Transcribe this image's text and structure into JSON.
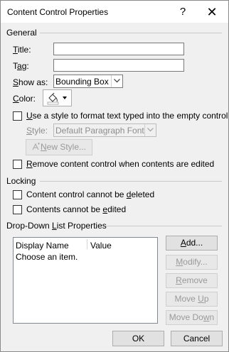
{
  "window": {
    "title": "Content Control Properties",
    "help_glyph": "?",
    "close_glyph": "✕"
  },
  "general": {
    "heading": "General",
    "title_label_ul": "T",
    "title_label_rest": "itle:",
    "title_value": "",
    "tag_label_pre": "T",
    "tag_label_ul": "a",
    "tag_label_rest": "g:",
    "tag_value": "",
    "show_as_label_ul": "S",
    "show_as_label_rest": "how as:",
    "show_as_value": "Bounding Box",
    "color_label_ul": "C",
    "color_label_rest": "olor:",
    "use_style_ul": "U",
    "use_style_rest": "se a style to format text typed into the empty control",
    "use_style_checked": false,
    "style_label_ul": "S",
    "style_label_rest": "tyle:",
    "style_value": "Default Paragraph Font",
    "new_style_label_ul": "N",
    "new_style_label_rest": "ew Style...",
    "remove_label_pre": "",
    "remove_label_ul": "R",
    "remove_label_rest": "emove content control when contents are edited",
    "remove_checked": false
  },
  "locking": {
    "heading": "Locking",
    "cannot_delete_pre": "Content control cannot be ",
    "cannot_delete_ul": "d",
    "cannot_delete_rest": "eleted",
    "cannot_delete_checked": false,
    "cannot_edit_pre": "Contents cannot be ",
    "cannot_edit_ul": "e",
    "cannot_edit_rest": "dited",
    "cannot_edit_checked": false
  },
  "dropdown": {
    "heading_pre": "Drop-Down ",
    "heading_ul": "L",
    "heading_rest": "ist Properties",
    "columns": [
      "Display Name",
      "Value"
    ],
    "items": [
      {
        "display": "Choose an item.",
        "value": ""
      }
    ],
    "add_ul": "A",
    "add_rest": "dd...",
    "modify_ul": "M",
    "modify_rest": "odify...",
    "remove_ul": "R",
    "remove_rest": "emove",
    "move_up_pre": "Move ",
    "move_up_ul": "U",
    "move_up_rest": "p",
    "move_down_pre": "Move Do",
    "move_down_ul": "w",
    "move_down_rest": "n"
  },
  "footer": {
    "ok": "OK",
    "cancel": "Cancel"
  },
  "colors": {
    "accent": "#0078d7",
    "disabled_text": "#8d8d8d"
  }
}
